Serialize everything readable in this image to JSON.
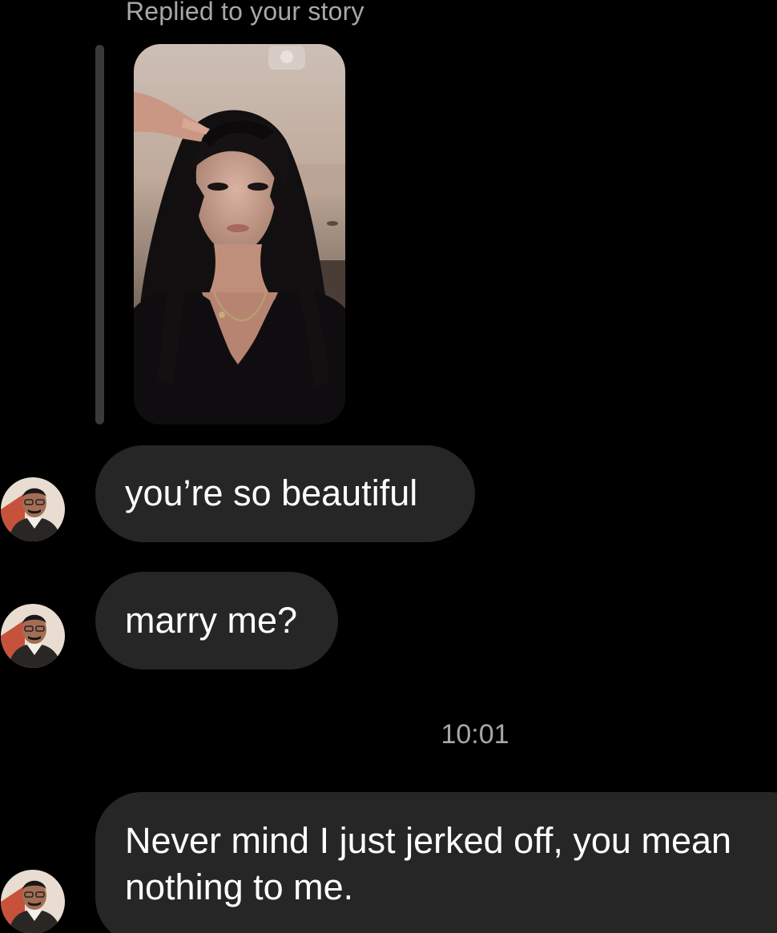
{
  "story_reply": {
    "header": "Replied to your story"
  },
  "messages": [
    {
      "text": "you’re so beautiful"
    },
    {
      "text": "marry me?"
    }
  ],
  "timestamp": "10:01",
  "last_message": {
    "line1": "Never mind I just jerked off, you mean",
    "line2": "nothing to me."
  },
  "colors": {
    "background": "#000000",
    "bubble": "#262626",
    "secondary_text": "#a8a8a8",
    "primary_text": "#ffffff"
  }
}
